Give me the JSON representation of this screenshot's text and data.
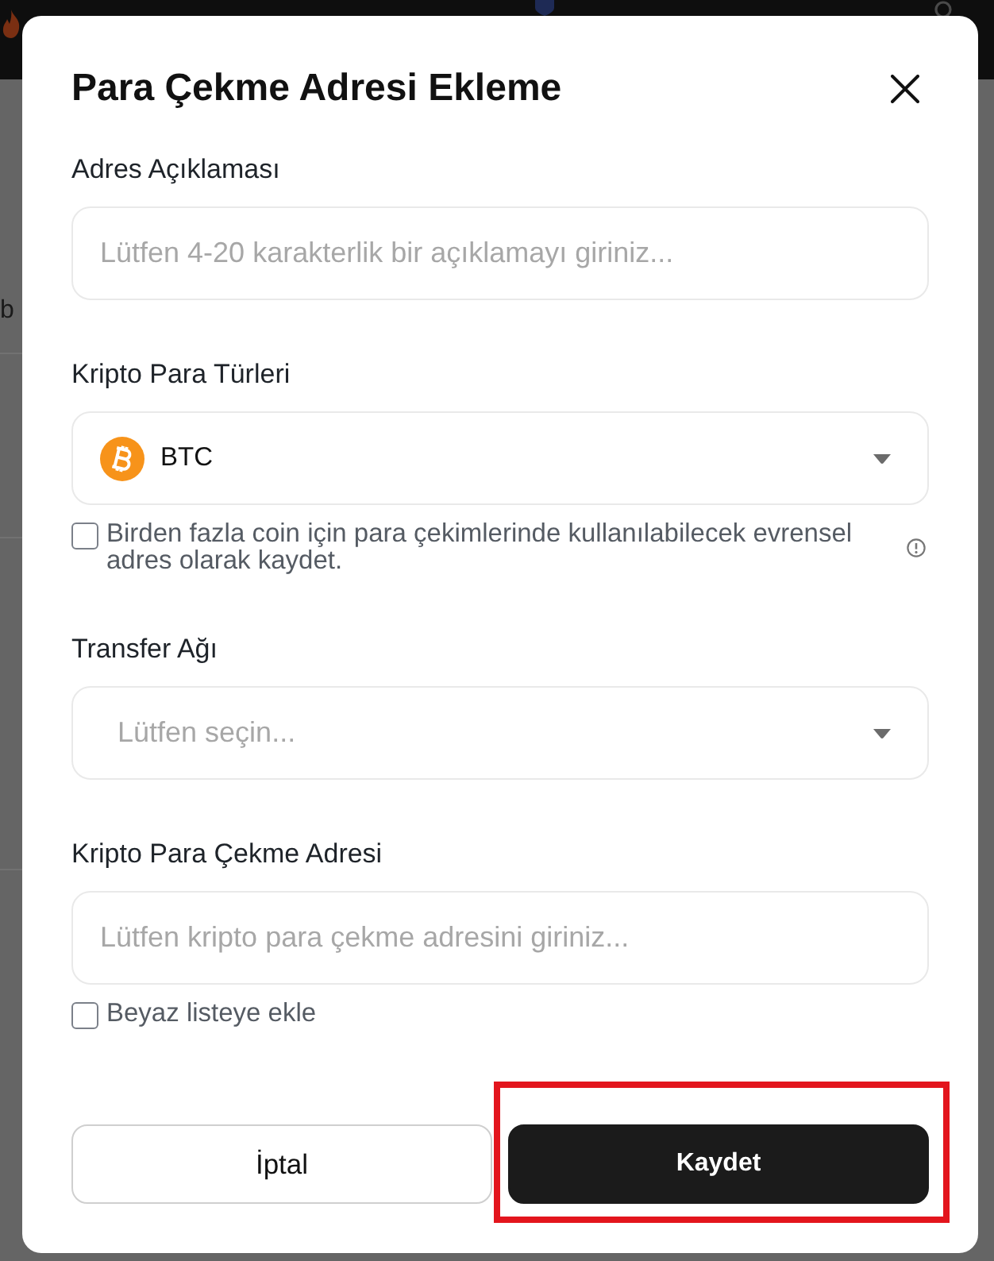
{
  "background": {
    "text_fragment": "b"
  },
  "dialog": {
    "title": "Para Çekme Adresi Ekleme",
    "fields": [
      {
        "kind": "text",
        "label": "Adres Açıklaması",
        "placeholder": "Lütfen 4-20 karakterlik bir açıklamayı giriniz..."
      },
      {
        "kind": "select",
        "label": "Kripto Para Türleri",
        "value": "BTC",
        "checkbox": {
          "label": "Birden fazla coin için para çekimlerinde kullanılabilecek evrensel adres olarak kaydet.",
          "checked": false,
          "info": true
        }
      },
      {
        "kind": "select",
        "label": "Transfer Ağı",
        "placeholder": "Lütfen seçin..."
      },
      {
        "kind": "text",
        "label": "Kripto Para Çekme Adresi",
        "placeholder": "Lütfen kripto para çekme adresini giriniz...",
        "checkbox": {
          "label": "Beyaz listeye ekle",
          "checked": false,
          "info": false
        }
      }
    ],
    "buttons": [
      {
        "kind": "secondary",
        "label": "İptal",
        "highlighted": false
      },
      {
        "kind": "primary",
        "label": "Kaydet",
        "highlighted": true
      }
    ]
  }
}
